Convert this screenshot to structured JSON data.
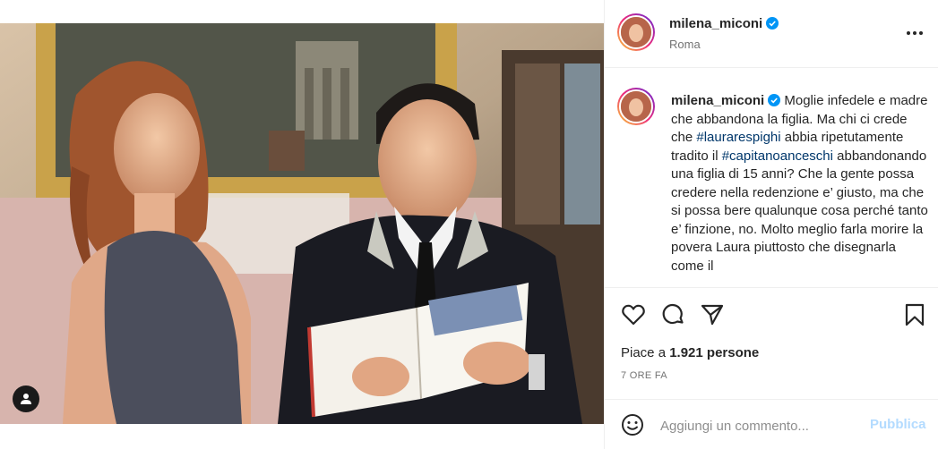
{
  "post": {
    "username": "milena_miconi",
    "location": "Roma",
    "caption": {
      "username": "milena_miconi",
      "segments": [
        {
          "text": " Moglie infedele e madre che abbandona la figlia. ",
          "type": "text"
        },
        {
          "text": "Ma chi ci crede che ",
          "type": "text"
        },
        {
          "text": "#laurarespighi",
          "type": "hashtag"
        },
        {
          "text": " abbia ripetutamente tradito il ",
          "type": "text"
        },
        {
          "text": "#capitanoanceschi",
          "type": "hashtag"
        },
        {
          "text": " abbandonando una figlia di 15 anni? Che la gente possa credere nella redenzione e’ giusto, ma che si possa bere qualunque cosa perché tanto e’ finzione, no. ",
          "type": "text"
        },
        {
          "text": "Molto meglio farla morire la povera Laura piuttosto che disegnarla come il",
          "type": "text"
        }
      ]
    },
    "likes_prefix": "Piace a ",
    "likes_count": "1.921",
    "likes_suffix": " persone",
    "timestamp": "7 ORE FA"
  },
  "comment": {
    "placeholder": "Aggiungi un commento...",
    "publish_label": "Pubblica"
  },
  "icons": {
    "like": "heart-icon",
    "comment": "comment-icon",
    "share": "share-icon",
    "save": "bookmark-icon",
    "more": "more-icon",
    "emoji": "emoji-icon",
    "tag": "user-tag-icon",
    "verified": "verified-badge-icon"
  },
  "colors": {
    "hashtag": "#00376b",
    "verified": "#0095f6",
    "publish_disabled": "#b3dbff",
    "secondary_text": "#737373"
  }
}
